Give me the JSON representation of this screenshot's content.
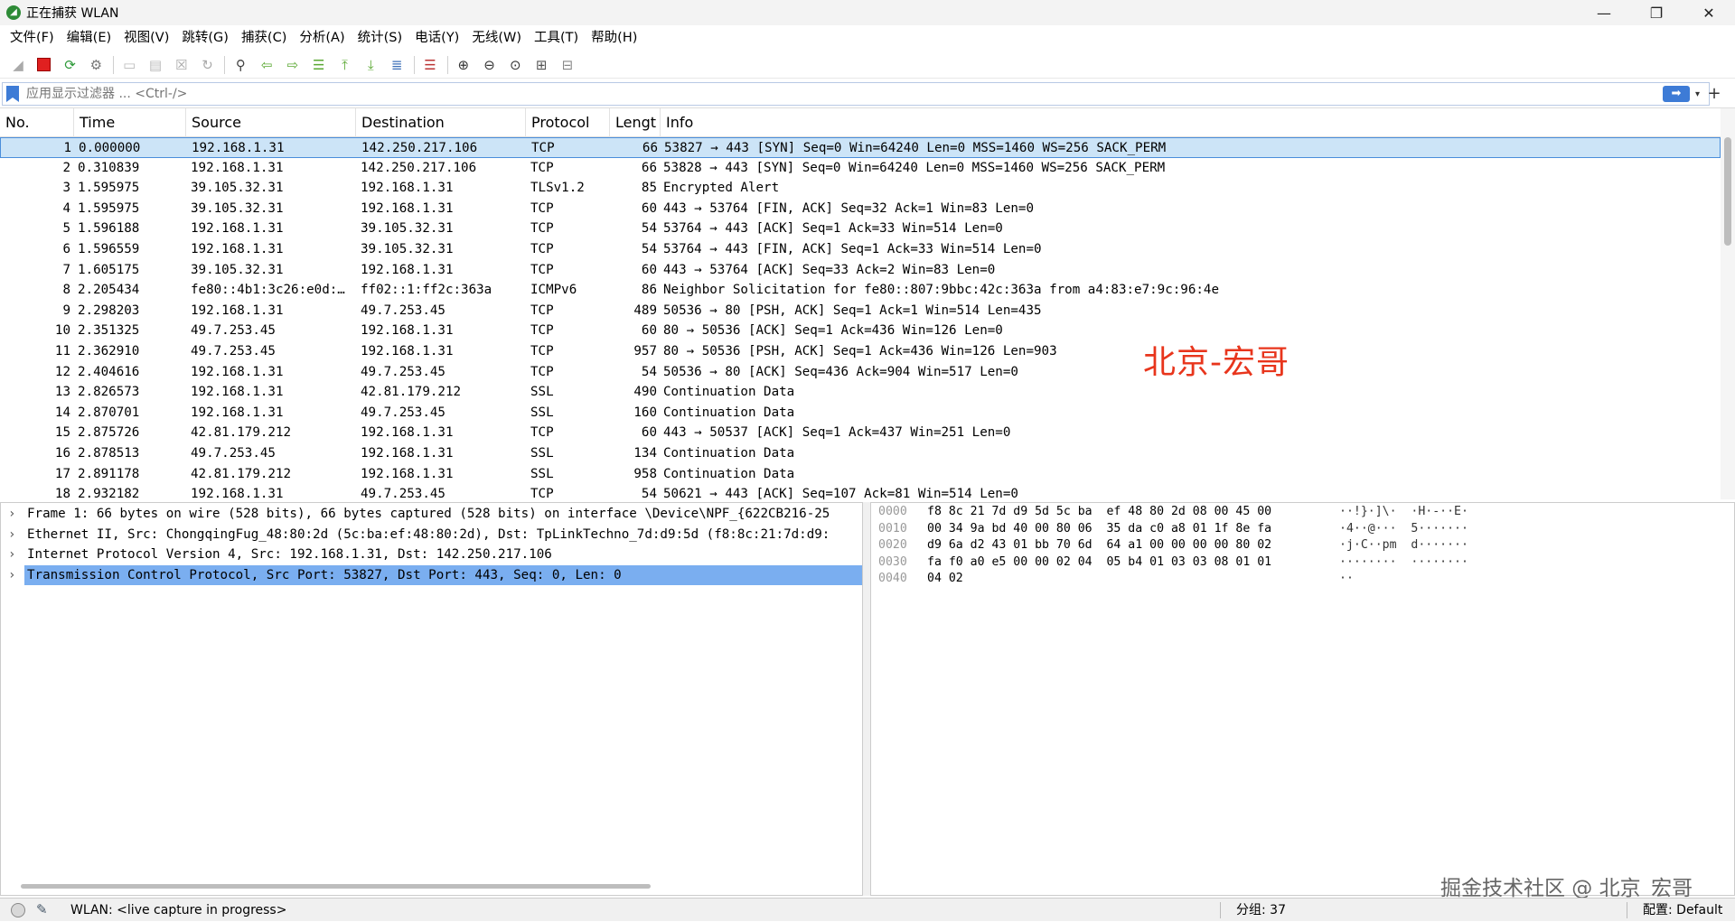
{
  "window": {
    "title": "正在捕获 WLAN",
    "minimize": "—",
    "restore": "❐",
    "close": "✕"
  },
  "menu": [
    "文件(F)",
    "编辑(E)",
    "视图(V)",
    "跳转(G)",
    "捕获(C)",
    "分析(A)",
    "统计(S)",
    "电话(Y)",
    "无线(W)",
    "工具(T)",
    "帮助(H)"
  ],
  "toolbar": {
    "icons": [
      "shark-fin-start-icon",
      "stop-capture-icon",
      "restart-capture-icon",
      "capture-options-icon",
      "open-file-icon",
      "save-file-icon",
      "close-file-icon",
      "reload-file-icon",
      "find-packet-icon",
      "go-back-icon",
      "go-forward-icon",
      "go-to-packet-icon",
      "go-first-icon",
      "go-last-icon",
      "autoscroll-icon",
      "colorize-icon",
      "zoom-in-icon",
      "zoom-out-icon",
      "zoom-normal-icon",
      "resize-columns-icon",
      "layout-icon"
    ]
  },
  "filter": {
    "placeholder": "应用显示过滤器 ... <Ctrl-/>",
    "apply": "➡",
    "dropdown": "▾",
    "add": "+"
  },
  "packet_list": {
    "columns": [
      "No.",
      "Time",
      "Source",
      "Destination",
      "Protocol",
      "Lengt",
      "Info"
    ],
    "rows": [
      {
        "no": "1",
        "time": "0.000000",
        "src": "192.168.1.31",
        "dst": "142.250.217.106",
        "proto": "TCP",
        "len": "66",
        "info": "53827 → 443 [SYN] Seq=0 Win=64240 Len=0 MSS=1460 WS=256 SACK_PERM",
        "color": "#e7e6ff"
      },
      {
        "no": "2",
        "time": "0.310839",
        "src": "192.168.1.31",
        "dst": "142.250.217.106",
        "proto": "TCP",
        "len": "66",
        "info": "53828 → 443 [SYN] Seq=0 Win=64240 Len=0 MSS=1460 WS=256 SACK_PERM",
        "color": "#ffffff"
      },
      {
        "no": "3",
        "time": "1.595975",
        "src": "39.105.32.31",
        "dst": "192.168.1.31",
        "proto": "TLSv1.2",
        "len": "85",
        "info": "Encrypted Alert",
        "color": "#ffffff"
      },
      {
        "no": "4",
        "time": "1.595975",
        "src": "39.105.32.31",
        "dst": "192.168.1.31",
        "proto": "TCP",
        "len": "60",
        "info": "443 → 53764 [FIN, ACK] Seq=32 Ack=1 Win=83 Len=0",
        "color": "#ffffff"
      },
      {
        "no": "5",
        "time": "1.596188",
        "src": "192.168.1.31",
        "dst": "39.105.32.31",
        "proto": "TCP",
        "len": "54",
        "info": "53764 → 443 [ACK] Seq=1 Ack=33 Win=514 Len=0",
        "color": "#ffffff"
      },
      {
        "no": "6",
        "time": "1.596559",
        "src": "192.168.1.31",
        "dst": "39.105.32.31",
        "proto": "TCP",
        "len": "54",
        "info": "53764 → 443 [FIN, ACK] Seq=1 Ack=33 Win=514 Len=0",
        "color": "#ffffff"
      },
      {
        "no": "7",
        "time": "1.605175",
        "src": "39.105.32.31",
        "dst": "192.168.1.31",
        "proto": "TCP",
        "len": "60",
        "info": "443 → 53764 [ACK] Seq=33 Ack=2 Win=83 Len=0",
        "color": "#ffffff"
      },
      {
        "no": "8",
        "time": "2.205434",
        "src": "fe80::4b1:3c26:e0d:…",
        "dst": "ff02::1:ff2c:363a",
        "proto": "ICMPv6",
        "len": "86",
        "info": "Neighbor Solicitation for fe80::807:9bbc:42c:363a from a4:83:e7:9c:96:4e",
        "color": "#ffffff"
      },
      {
        "no": "9",
        "time": "2.298203",
        "src": "192.168.1.31",
        "dst": "49.7.253.45",
        "proto": "TCP",
        "len": "489",
        "info": "50536 → 80 [PSH, ACK] Seq=1 Ack=1 Win=514 Len=435",
        "color": "#ffffff"
      },
      {
        "no": "10",
        "time": "2.351325",
        "src": "49.7.253.45",
        "dst": "192.168.1.31",
        "proto": "TCP",
        "len": "60",
        "info": "80 → 50536 [ACK] Seq=1 Ack=436 Win=126 Len=0",
        "color": "#ffffff"
      },
      {
        "no": "11",
        "time": "2.362910",
        "src": "49.7.253.45",
        "dst": "192.168.1.31",
        "proto": "TCP",
        "len": "957",
        "info": "80 → 50536 [PSH, ACK] Seq=1 Ack=436 Win=126 Len=903",
        "color": "#ffffff"
      },
      {
        "no": "12",
        "time": "2.404616",
        "src": "192.168.1.31",
        "dst": "49.7.253.45",
        "proto": "TCP",
        "len": "54",
        "info": "50536 → 80 [ACK] Seq=436 Ack=904 Win=517 Len=0",
        "color": "#ffffff"
      },
      {
        "no": "13",
        "time": "2.826573",
        "src": "192.168.1.31",
        "dst": "42.81.179.212",
        "proto": "SSL",
        "len": "490",
        "info": "Continuation Data",
        "color": "#ffffff"
      },
      {
        "no": "14",
        "time": "2.870701",
        "src": "192.168.1.31",
        "dst": "49.7.253.45",
        "proto": "SSL",
        "len": "160",
        "info": "Continuation Data",
        "color": "#ffffff"
      },
      {
        "no": "15",
        "time": "2.875726",
        "src": "42.81.179.212",
        "dst": "192.168.1.31",
        "proto": "TCP",
        "len": "60",
        "info": "443 → 50537 [ACK] Seq=1 Ack=437 Win=251 Len=0",
        "color": "#ffffff"
      },
      {
        "no": "16",
        "time": "2.878513",
        "src": "49.7.253.45",
        "dst": "192.168.1.31",
        "proto": "SSL",
        "len": "134",
        "info": "Continuation Data",
        "color": "#ffffff"
      },
      {
        "no": "17",
        "time": "2.891178",
        "src": "42.81.179.212",
        "dst": "192.168.1.31",
        "proto": "SSL",
        "len": "958",
        "info": "Continuation Data",
        "color": "#ffffff"
      },
      {
        "no": "18",
        "time": "2.932182",
        "src": "192.168.1.31",
        "dst": "49.7.253.45",
        "proto": "TCP",
        "len": "54",
        "info": "50621 → 443 [ACK] Seq=107 Ack=81 Win=514 Len=0",
        "color": "#ffffff"
      }
    ]
  },
  "watermark_red": "北京-宏哥",
  "details": [
    {
      "text": "Frame 1: 66 bytes on wire (528 bits), 66 bytes captured (528 bits) on interface \\Device\\NPF_{622CB216-25",
      "selected": false
    },
    {
      "text": "Ethernet II, Src: ChongqingFug_48:80:2d (5c:ba:ef:48:80:2d), Dst: TpLinkTechno_7d:d9:5d (f8:8c:21:7d:d9:",
      "selected": false
    },
    {
      "text": "Internet Protocol Version 4, Src: 192.168.1.31, Dst: 142.250.217.106",
      "selected": false
    },
    {
      "text": "Transmission Control Protocol, Src Port: 53827, Dst Port: 443, Seq: 0, Len: 0",
      "selected": true
    }
  ],
  "detail_arrow": "›",
  "bytes": [
    {
      "offset": "0000",
      "hex": "f8 8c 21 7d d9 5d 5c ba  ef 48 80 2d 08 00 45 00",
      "ascii": "··!}·]\\·  ·H·-··E·"
    },
    {
      "offset": "0010",
      "hex": "00 34 9a bd 40 00 80 06  35 da c0 a8 01 1f 8e fa",
      "ascii": "·4··@···  5·······"
    },
    {
      "offset": "0020",
      "hex": "d9 6a d2 43 01 bb 70 6d  64 a1 00 00 00 00 80 02",
      "ascii": "·j·C··pm  d·······"
    },
    {
      "offset": "0030",
      "hex": "fa f0 a0 e5 00 00 02 04  05 b4 01 03 03 08 01 01",
      "ascii": "········  ········"
    },
    {
      "offset": "0040",
      "hex": "04 02",
      "ascii": "··"
    }
  ],
  "watermark_gray": "掘金技术社区 @ 北京_宏哥",
  "status": {
    "capture": "WLAN: <live capture in progress>",
    "packets": "分组: 37",
    "profile": "配置: Default"
  }
}
